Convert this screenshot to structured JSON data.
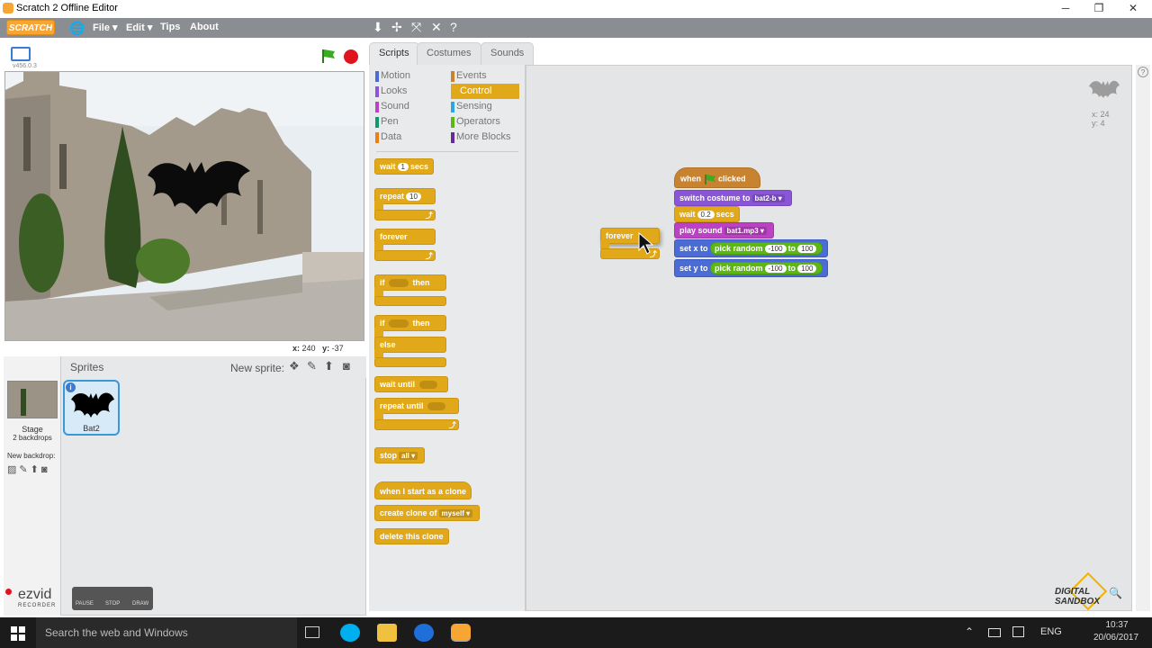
{
  "window": {
    "title": "Scratch 2 Offline Editor",
    "controls": [
      "─",
      "❐",
      "✕"
    ]
  },
  "menu": {
    "logo": "SCRATCH",
    "items": [
      "File ▾",
      "Edit ▾",
      "Tips",
      "About"
    ]
  },
  "stage": {
    "version": "v456.0.3",
    "coords_x_label": "x:",
    "coords_x": "240",
    "coords_y_label": "y:",
    "coords_y": "-37"
  },
  "tabs": [
    "Scripts",
    "Costumes",
    "Sounds"
  ],
  "categories": {
    "left": [
      {
        "label": "Motion",
        "color": "#4a6cd4"
      },
      {
        "label": "Looks",
        "color": "#8a55d7"
      },
      {
        "label": "Sound",
        "color": "#bb42c3"
      },
      {
        "label": "Pen",
        "color": "#0e9a6c"
      },
      {
        "label": "Data",
        "color": "#ee7d16"
      }
    ],
    "right": [
      {
        "label": "Events",
        "color": "#c88330"
      },
      {
        "label": "Control",
        "color": "#e1a91a"
      },
      {
        "label": "Sensing",
        "color": "#2ca5e2"
      },
      {
        "label": "Operators",
        "color": "#5cb712"
      },
      {
        "label": "More Blocks",
        "color": "#632d99"
      }
    ]
  },
  "palette": {
    "wait": "wait",
    "wait_val": "1",
    "wait_secs": "secs",
    "repeat": "repeat",
    "repeat_val": "10",
    "forever": "forever",
    "if": "if",
    "then": "then",
    "else": "else",
    "wait_until": "wait until",
    "repeat_until": "repeat until",
    "stop": "stop",
    "stop_val": "all",
    "clone_hat": "when I start as a clone",
    "create_clone": "create clone of",
    "create_clone_val": "myself",
    "delete_clone": "delete this clone"
  },
  "script": {
    "when": "when",
    "clicked": "clicked",
    "switch_costume": "switch costume to",
    "costume_val": "bat2-b",
    "wait": "wait",
    "wait_val": "0.2",
    "secs": "secs",
    "play_sound": "play sound",
    "sound_val": "bat1.mp3",
    "set_x": "set x to",
    "set_y": "set y to",
    "pick_random": "pick random",
    "rand_min": "-100",
    "to": "to",
    "rand_max": "100",
    "forever": "forever"
  },
  "sprite_info": {
    "x_label": "x:",
    "x": "24",
    "y_label": "y:",
    "y": "4"
  },
  "sprites": {
    "title": "Sprites",
    "new_sprite": "New sprite:",
    "items": [
      {
        "name": "Bat2"
      }
    ]
  },
  "stage_panel": {
    "label": "Stage",
    "backdrops": "2 backdrops",
    "new_backdrop": "New backdrop:"
  },
  "ezvid": {
    "brand": "ezvid",
    "sub": "RECORDER",
    "pause": "PAUSE",
    "stop": "STOP",
    "draw": "DRAW"
  },
  "watermark": {
    "line1": "DIGITAL",
    "line2": "SANDBOX"
  },
  "taskbar": {
    "search": "Search the web and Windows",
    "lang": "ENG",
    "time": "10:37",
    "date": "20/06/2017"
  }
}
